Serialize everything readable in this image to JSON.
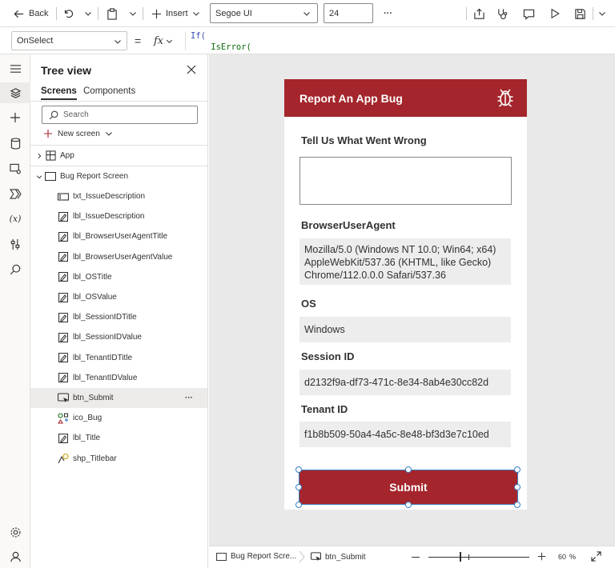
{
  "toolbar": {
    "back_label": "Back",
    "insert_label": "Insert",
    "font_family": "Segoe UI",
    "font_size": "24",
    "more_label": "···"
  },
  "formula": {
    "property": "OnSelect",
    "equals": "=",
    "fx": "fx",
    "line1": "If(",
    "line2": "    IsError("
  },
  "tree": {
    "title": "Tree view",
    "tabs": [
      "Screens",
      "Components"
    ],
    "search_placeholder": "Search",
    "new_screen_label": "New screen",
    "app_label": "App",
    "screen_label": "Bug Report Screen",
    "selected_more": "···",
    "items": [
      {
        "label": "txt_IssueDescription",
        "icon": "text-input-icon"
      },
      {
        "label": "lbl_IssueDescription",
        "icon": "label-icon"
      },
      {
        "label": "lbl_BrowserUserAgentTitle",
        "icon": "label-icon"
      },
      {
        "label": "lbl_BrowserUserAgentValue",
        "icon": "label-icon"
      },
      {
        "label": "lbl_OSTitle",
        "icon": "label-icon"
      },
      {
        "label": "lbl_OSValue",
        "icon": "label-icon"
      },
      {
        "label": "lbl_SessionIDTitle",
        "icon": "label-icon"
      },
      {
        "label": "lbl_SessionIDValue",
        "icon": "label-icon"
      },
      {
        "label": "lbl_TenantIDTitle",
        "icon": "label-icon"
      },
      {
        "label": "lbl_TenantIDValue",
        "icon": "label-icon"
      },
      {
        "label": "btn_Submit",
        "icon": "button-icon",
        "selected": true
      },
      {
        "label": "ico_Bug",
        "icon": "icons-icon"
      },
      {
        "label": "lbl_Title",
        "icon": "label-icon"
      },
      {
        "label": "shp_Titlebar",
        "icon": "shape-icon"
      }
    ]
  },
  "app": {
    "title": "Report An App Bug",
    "issue_label": "Tell Us What Went Wrong",
    "browser_label": "BrowserUserAgent",
    "browser_value": "Mozilla/5.0 (Windows NT 10.0; Win64; x64) AppleWebKit/537.36 (KHTML, like Gecko) Chrome/112.0.0.0 Safari/537.36",
    "os_label": "OS",
    "os_value": "Windows",
    "session_label": "Session ID",
    "session_value": "d2132f9a-df73-471c-8e34-8ab4e30cc82d",
    "tenant_label": "Tenant ID",
    "tenant_value": "f1b8b509-50a4-4a5c-8e48-bf3d3e7c10ed",
    "submit_label": "Submit",
    "accent_color": "#a4262c"
  },
  "bottom": {
    "screen_crumb": "Bug Report Scre...",
    "control_crumb": "btn_Submit",
    "zoom_value": "60",
    "zoom_unit": "%"
  }
}
